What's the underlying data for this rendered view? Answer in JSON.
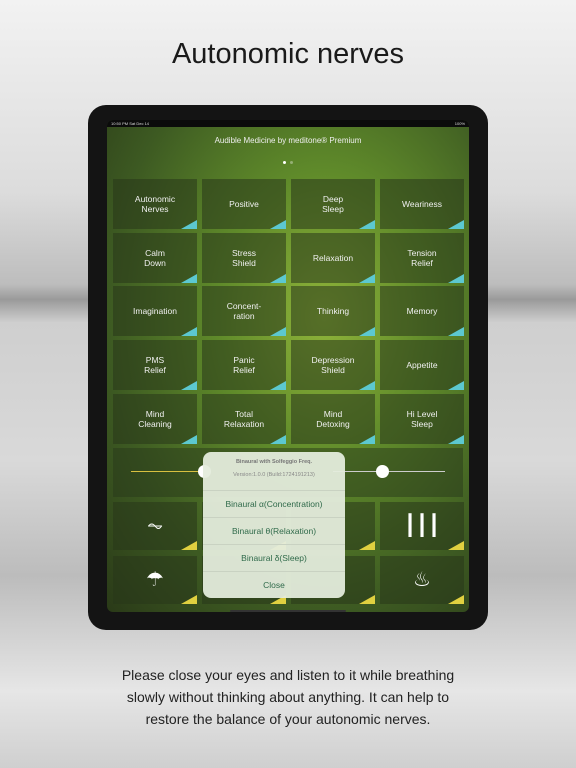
{
  "title": "Autonomic nerves",
  "status": {
    "time": "10:50 PM  Sat Dec 14",
    "battery": "100%"
  },
  "header": "Audible Medicine by meditone® Premium",
  "accent_colors": {
    "cyan": "#5cc8d0",
    "yellow": "#e0d040"
  },
  "grid": [
    [
      "Autonomic\nNerves",
      "Positive",
      "Deep\nSleep",
      "Weariness"
    ],
    [
      "Calm\nDown",
      "Stress\nShield",
      "Relaxation",
      "Tension\nRelief"
    ],
    [
      "Imagination",
      "Concent-\nration",
      "Thinking",
      "Memory"
    ],
    [
      "PMS\nRelief",
      "Panic\nRelief",
      "Depression\nShield",
      "Appetite"
    ],
    [
      "Mind\nCleaning",
      "Total\nRelaxation",
      "Mind\nDetoxing",
      "Hi Level\nSleep"
    ]
  ],
  "icons": [
    [
      "heartbeat-icon",
      "",
      "",
      "sound-wave-icon"
    ],
    [
      "umbrella-icon",
      "",
      "",
      "campfire-icon"
    ]
  ],
  "popup": {
    "title": "Binaural with Solfeggio Freq.",
    "version": "Version:1.0.0 (Build:1724191213)",
    "items": [
      "Binaural α(Concentration)",
      "Binaural θ(Relaxation)",
      "Binaural δ(Sleep)",
      "Close"
    ]
  },
  "footer": [
    "Please close your eyes and listen to it while breathing",
    "slowly without thinking about anything. It can help to",
    "restore the balance of your autonomic nerves."
  ]
}
